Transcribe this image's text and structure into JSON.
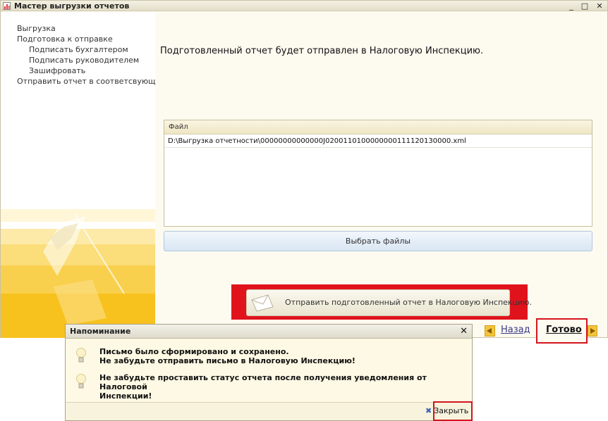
{
  "window": {
    "title": "Мастер выгрузки отчетов",
    "minimize": "_",
    "maximize": "□",
    "close": "✕"
  },
  "sidebar": {
    "steps": [
      {
        "label": "Выгрузка"
      },
      {
        "label": "Подготовка к отправке"
      },
      {
        "label": "Подписать бухгалтером"
      },
      {
        "label": "Подписать руководителем"
      },
      {
        "label": "Зашифровать"
      },
      {
        "label": "Отправить отчет в соответсвующий ор"
      }
    ]
  },
  "main": {
    "message": "Подготовленный отчет будет отправлен в Налоговую Инспекцию.",
    "files": {
      "header": "Файл",
      "rows": [
        "D:\\Выгрузка отчетности\\00000000000000J0200110100000000111120130000.xml"
      ]
    },
    "select_files_label": "Выбрать файлы",
    "send_label": "Отправить подготовленный отчет в Налоговую Инспекцию."
  },
  "nav": {
    "back_label": "Назад",
    "finish_label": "Готово"
  },
  "dialog": {
    "title": "Напоминание",
    "close_glyph": "✕",
    "messages": [
      {
        "line1": "Письмо было сформировано и сохранено.",
        "line2": "Не забудьте отправить письмо в Налоговую Инспекцию!"
      },
      {
        "line1": "Не забудьте проставить статус отчета после получения уведомления от Налоговой",
        "line2": "Инспекции!"
      }
    ],
    "close_label": "Закрыть"
  },
  "icons": {
    "app": "report-wizard-icon",
    "message": "lightbulb-icon",
    "send": "envelope-icon",
    "back": "arrow-left-icon",
    "finish": "arrow-right-icon"
  },
  "colors": {
    "accent_red": "#e0131c",
    "link_blue": "#3a3a8a",
    "nav_arrow": "#f2c53a"
  }
}
